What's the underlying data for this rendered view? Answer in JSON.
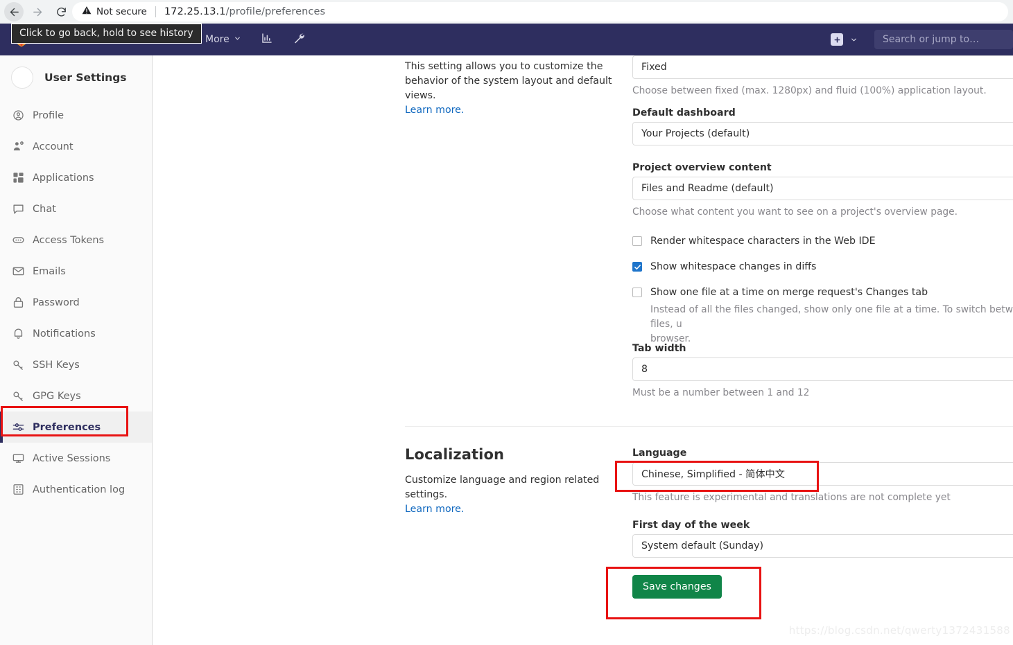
{
  "browser": {
    "back_tooltip": "Click to go back, hold to see history",
    "security_label": "Not secure",
    "url_host": "172.25.13.1",
    "url_path": "/profile/preferences",
    "back_icon": "arrow-left-icon",
    "forward_icon": "arrow-right-icon",
    "reload_icon": "reload-icon",
    "warning_icon": "warning-triangle-icon"
  },
  "navbar": {
    "logo": "gitlab-tanuki-logo",
    "items": [
      {
        "label": "More",
        "icon": "chevron-down-icon"
      }
    ],
    "icons": [
      "analytics-chart-icon",
      "wrench-icon"
    ],
    "create_label": "+",
    "create_icon": "plus-square-icon",
    "create_chevron": "chevron-down-icon",
    "search_placeholder": "Search or jump to…",
    "background": "#2e2e5f"
  },
  "sidebar": {
    "title": "User Settings",
    "avatar": "user-avatar",
    "items": [
      {
        "label": "Profile",
        "icon": "user-circle-icon",
        "active": false
      },
      {
        "label": "Account",
        "icon": "account-gear-icon",
        "active": false
      },
      {
        "label": "Applications",
        "icon": "grid-apps-icon",
        "active": false
      },
      {
        "label": "Chat",
        "icon": "comment-icon",
        "active": false
      },
      {
        "label": "Access Tokens",
        "icon": "token-pill-icon",
        "active": false
      },
      {
        "label": "Emails",
        "icon": "envelope-icon",
        "active": false
      },
      {
        "label": "Password",
        "icon": "lock-icon",
        "active": false
      },
      {
        "label": "Notifications",
        "icon": "bell-icon",
        "active": false
      },
      {
        "label": "SSH Keys",
        "icon": "key-icon",
        "active": false
      },
      {
        "label": "GPG Keys",
        "icon": "key-icon",
        "active": false
      },
      {
        "label": "Preferences",
        "icon": "sliders-icon",
        "active": true
      },
      {
        "label": "Active Sessions",
        "icon": "monitor-icon",
        "active": false
      },
      {
        "label": "Authentication log",
        "icon": "list-table-icon",
        "active": false
      }
    ],
    "active_color": "#2e2e5f"
  },
  "behavior_section": {
    "description": "This setting allows you to customize the behavior of the system layout and default views.",
    "learn_more": "Learn more.",
    "layout_value": "Fixed",
    "layout_hint": "Choose between fixed (max. 1280px) and fluid (100%) application layout.",
    "dashboard_label": "Default dashboard",
    "dashboard_value": "Your Projects (default)",
    "overview_label": "Project overview content",
    "overview_value": "Files and Readme (default)",
    "overview_hint": "Choose what content you want to see on a project's overview page.",
    "checkboxes": [
      {
        "label": "Render whitespace characters in the Web IDE",
        "checked": false,
        "hint": ""
      },
      {
        "label": "Show whitespace changes in diffs",
        "checked": true,
        "hint": ""
      },
      {
        "label": "Show one file at a time on merge request's Changes tab",
        "checked": false,
        "hint": "Instead of all the files changed, show only one file at a time. To switch between files, u"
      },
      {
        "label": "",
        "checked": false,
        "hint": "browser."
      }
    ],
    "tab_width_label": "Tab width",
    "tab_width_value": "8",
    "tab_width_hint": "Must be a number between 1 and 12"
  },
  "localization_section": {
    "title": "Localization",
    "description": "Customize language and region related settings.",
    "learn_more": "Learn more.",
    "language_label": "Language",
    "language_value": "Chinese, Simplified - 简体中文",
    "language_hint": "This feature is experimental and translations are not complete yet",
    "first_day_label": "First day of the week",
    "first_day_value": "System default (Sunday)",
    "save_label": "Save changes",
    "save_color": "#108548"
  },
  "annotations": {
    "highlight_color": "#e81313",
    "boxes": [
      "preferences-sidebar-item",
      "language-select",
      "save-changes-button"
    ]
  },
  "watermark": "https://blog.csdn.net/qwerty1372431588"
}
